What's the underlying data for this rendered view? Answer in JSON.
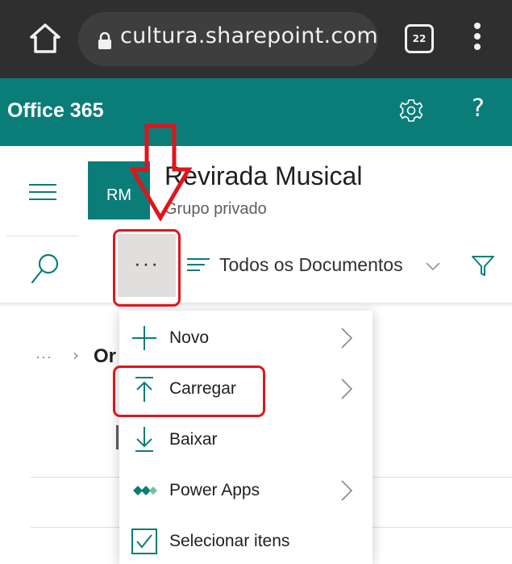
{
  "browser": {
    "url": "cultura.sharepoint.com",
    "tab_count": "22",
    "icons": [
      "home-icon",
      "lock-icon",
      "tabs-icon",
      "kebab-menu-icon"
    ]
  },
  "suite_bar": {
    "title": "Office 365",
    "icons": [
      "gear-icon",
      "help-icon"
    ],
    "help_glyph": "?"
  },
  "site": {
    "logo_initials": "RM",
    "title": "Revirada Musical",
    "subtitle": "Grupo privado"
  },
  "command_bar": {
    "more_glyph": "···",
    "view_name": "Todos os Documentos"
  },
  "breadcrumb": {
    "ellipsis": "···",
    "separator": "›",
    "current": "Or"
  },
  "context_menu": {
    "items": [
      {
        "label": "Novo",
        "icon": "plus-icon",
        "submenu": true
      },
      {
        "label": "Carregar",
        "icon": "upload-icon",
        "submenu": true
      },
      {
        "label": "Baixar",
        "icon": "download-icon",
        "submenu": false
      },
      {
        "label": "Power Apps",
        "icon": "power-apps-icon",
        "submenu": true
      },
      {
        "label": "Selecionar itens",
        "icon": "checkbox-icon",
        "submenu": false
      }
    ]
  },
  "colors": {
    "accent": "#0b7d78",
    "browser_bar": "#2f2f2f",
    "annotation": "#e1141c"
  }
}
